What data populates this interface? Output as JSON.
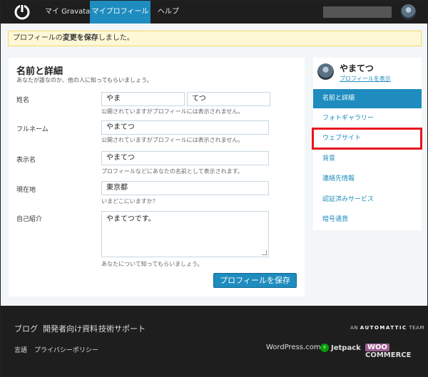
{
  "nav": {
    "items": [
      {
        "label": "マイ Gravatar",
        "active": false
      },
      {
        "label": "マイプロフィール",
        "active": true
      },
      {
        "label": "ヘルプ",
        "active": false
      }
    ]
  },
  "notice": {
    "prefix": "プロフィールの",
    "bold": "変更を保存",
    "suffix": "しました。"
  },
  "form": {
    "title": "名前と詳細",
    "subtitle": "あなたが誰なのか、他の人に知ってもらいましょう。",
    "name_label": "姓名",
    "last_name": "やま",
    "first_name": "てつ",
    "name_hint": "公開されていますがプロフィールには表示されません。",
    "fullname_label": "フルネーム",
    "fullname": "やまてつ",
    "fullname_hint": "公開されていますがプロフィールには表示されません。",
    "display_label": "表示名",
    "display_name": "やまてつ",
    "display_hint": "プロフィールなどにあなたの名前として表示されます。",
    "location_label": "現在地",
    "location": "東京都",
    "location_hint": "いまどこにいますか？",
    "about_label": "自己紹介",
    "about": "やまてつです。",
    "about_hint": "あなたについて知ってもらいましょう。",
    "save_label": "プロフィールを保存"
  },
  "sidebar": {
    "user_name": "やまてつ",
    "view_profile": "プロフィールを表示",
    "items": [
      {
        "label": "名前と詳細",
        "active": true
      },
      {
        "label": "フォトギャラリー",
        "active": false
      },
      {
        "label": "ウェブサイト",
        "active": false
      },
      {
        "label": "背景",
        "active": false
      },
      {
        "label": "連絡先情報",
        "active": false
      },
      {
        "label": "認証済みサービス",
        "active": false
      },
      {
        "label": "暗号通貨",
        "active": false
      }
    ]
  },
  "footer": {
    "links": [
      "ブログ",
      "開発者向け資料",
      "技術サポート"
    ],
    "sub_links": [
      "言語",
      "プライバシーポリシー"
    ],
    "automattic_pre": "AN",
    "automattic": "AUTOMATTIC",
    "automattic_post": "TEAM",
    "brands": {
      "wordpress": "WordPress.com",
      "jetpack": "Jetpack",
      "woo": "WOO",
      "commerce": "COMMERCE"
    }
  },
  "colors": {
    "accent": "#1e8cbe",
    "highlight": "#e8141e",
    "notice_bg": "#fff8d6"
  }
}
